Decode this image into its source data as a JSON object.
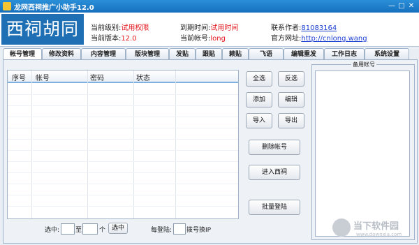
{
  "window": {
    "title": "龙网西祠推广小助手12.0"
  },
  "header": {
    "logo_text": "西祠胡同",
    "level_label": "当前级别:",
    "level_value": "试用权限",
    "expire_label": "到期时间:",
    "expire_value": "试用时间",
    "author_label": "联系作者:",
    "author_value": "81083164",
    "version_label": "当前版本:",
    "version_value": "12.0",
    "account_label": "当前帐号:",
    "account_value": "long",
    "site_label": "官方网址:",
    "site_value": "http://cnlong.wang"
  },
  "tabs": [
    "帐号管理",
    "修改资料",
    "内容管理",
    "版块管理",
    "发贴",
    "跟贴",
    "赖贴",
    "飞语",
    "编辑重发",
    "工作日志",
    "系统设置"
  ],
  "table": {
    "columns": [
      "序号",
      "帐号",
      "密码",
      "状态"
    ]
  },
  "buttons": {
    "select_all": "全选",
    "invert": "反选",
    "add": "添加",
    "edit": "编辑",
    "import": "导入",
    "export": "导出",
    "delete_account": "删除帐号",
    "enter_xici": "进入西祠",
    "batch_login": "批量登陆"
  },
  "spare": {
    "legend": "备用帐号"
  },
  "bottom": {
    "select_label": "选中:",
    "to_label": "至",
    "unit_label": "个",
    "select_button": "选中",
    "every_login_label": "每登陆:",
    "dial_label": "拨号换IP"
  },
  "watermark": {
    "text": "当下软件园",
    "sub": "www.downxia.com"
  },
  "colors": {
    "accent": "#1e6fb3",
    "highlight_red": "#e4161b",
    "link_blue": "#1a3fd1"
  }
}
